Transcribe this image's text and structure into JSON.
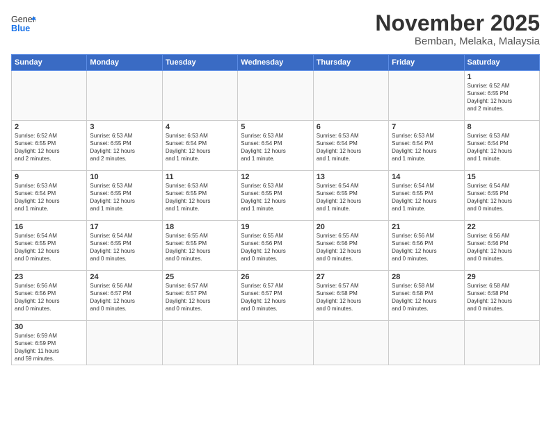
{
  "header": {
    "logo_general": "General",
    "logo_blue": "Blue",
    "title": "November 2025",
    "subtitle": "Bemban, Melaka, Malaysia"
  },
  "days_of_week": [
    "Sunday",
    "Monday",
    "Tuesday",
    "Wednesday",
    "Thursday",
    "Friday",
    "Saturday"
  ],
  "weeks": [
    [
      {
        "day": "",
        "info": ""
      },
      {
        "day": "",
        "info": ""
      },
      {
        "day": "",
        "info": ""
      },
      {
        "day": "",
        "info": ""
      },
      {
        "day": "",
        "info": ""
      },
      {
        "day": "",
        "info": ""
      },
      {
        "day": "1",
        "info": "Sunrise: 6:52 AM\nSunset: 6:55 PM\nDaylight: 12 hours\nand 2 minutes."
      }
    ],
    [
      {
        "day": "2",
        "info": "Sunrise: 6:52 AM\nSunset: 6:55 PM\nDaylight: 12 hours\nand 2 minutes."
      },
      {
        "day": "3",
        "info": "Sunrise: 6:53 AM\nSunset: 6:55 PM\nDaylight: 12 hours\nand 2 minutes."
      },
      {
        "day": "4",
        "info": "Sunrise: 6:53 AM\nSunset: 6:54 PM\nDaylight: 12 hours\nand 1 minute."
      },
      {
        "day": "5",
        "info": "Sunrise: 6:53 AM\nSunset: 6:54 PM\nDaylight: 12 hours\nand 1 minute."
      },
      {
        "day": "6",
        "info": "Sunrise: 6:53 AM\nSunset: 6:54 PM\nDaylight: 12 hours\nand 1 minute."
      },
      {
        "day": "7",
        "info": "Sunrise: 6:53 AM\nSunset: 6:54 PM\nDaylight: 12 hours\nand 1 minute."
      },
      {
        "day": "8",
        "info": "Sunrise: 6:53 AM\nSunset: 6:54 PM\nDaylight: 12 hours\nand 1 minute."
      }
    ],
    [
      {
        "day": "9",
        "info": "Sunrise: 6:53 AM\nSunset: 6:54 PM\nDaylight: 12 hours\nand 1 minute."
      },
      {
        "day": "10",
        "info": "Sunrise: 6:53 AM\nSunset: 6:55 PM\nDaylight: 12 hours\nand 1 minute."
      },
      {
        "day": "11",
        "info": "Sunrise: 6:53 AM\nSunset: 6:55 PM\nDaylight: 12 hours\nand 1 minute."
      },
      {
        "day": "12",
        "info": "Sunrise: 6:53 AM\nSunset: 6:55 PM\nDaylight: 12 hours\nand 1 minute."
      },
      {
        "day": "13",
        "info": "Sunrise: 6:54 AM\nSunset: 6:55 PM\nDaylight: 12 hours\nand 1 minute."
      },
      {
        "day": "14",
        "info": "Sunrise: 6:54 AM\nSunset: 6:55 PM\nDaylight: 12 hours\nand 1 minute."
      },
      {
        "day": "15",
        "info": "Sunrise: 6:54 AM\nSunset: 6:55 PM\nDaylight: 12 hours\nand 0 minutes."
      }
    ],
    [
      {
        "day": "16",
        "info": "Sunrise: 6:54 AM\nSunset: 6:55 PM\nDaylight: 12 hours\nand 0 minutes."
      },
      {
        "day": "17",
        "info": "Sunrise: 6:54 AM\nSunset: 6:55 PM\nDaylight: 12 hours\nand 0 minutes."
      },
      {
        "day": "18",
        "info": "Sunrise: 6:55 AM\nSunset: 6:55 PM\nDaylight: 12 hours\nand 0 minutes."
      },
      {
        "day": "19",
        "info": "Sunrise: 6:55 AM\nSunset: 6:56 PM\nDaylight: 12 hours\nand 0 minutes."
      },
      {
        "day": "20",
        "info": "Sunrise: 6:55 AM\nSunset: 6:56 PM\nDaylight: 12 hours\nand 0 minutes."
      },
      {
        "day": "21",
        "info": "Sunrise: 6:56 AM\nSunset: 6:56 PM\nDaylight: 12 hours\nand 0 minutes."
      },
      {
        "day": "22",
        "info": "Sunrise: 6:56 AM\nSunset: 6:56 PM\nDaylight: 12 hours\nand 0 minutes."
      }
    ],
    [
      {
        "day": "23",
        "info": "Sunrise: 6:56 AM\nSunset: 6:56 PM\nDaylight: 12 hours\nand 0 minutes."
      },
      {
        "day": "24",
        "info": "Sunrise: 6:56 AM\nSunset: 6:57 PM\nDaylight: 12 hours\nand 0 minutes."
      },
      {
        "day": "25",
        "info": "Sunrise: 6:57 AM\nSunset: 6:57 PM\nDaylight: 12 hours\nand 0 minutes."
      },
      {
        "day": "26",
        "info": "Sunrise: 6:57 AM\nSunset: 6:57 PM\nDaylight: 12 hours\nand 0 minutes."
      },
      {
        "day": "27",
        "info": "Sunrise: 6:57 AM\nSunset: 6:58 PM\nDaylight: 12 hours\nand 0 minutes."
      },
      {
        "day": "28",
        "info": "Sunrise: 6:58 AM\nSunset: 6:58 PM\nDaylight: 12 hours\nand 0 minutes."
      },
      {
        "day": "29",
        "info": "Sunrise: 6:58 AM\nSunset: 6:58 PM\nDaylight: 12 hours\nand 0 minutes."
      }
    ],
    [
      {
        "day": "30",
        "info": "Sunrise: 6:59 AM\nSunset: 6:59 PM\nDaylight: 11 hours\nand 59 minutes."
      },
      {
        "day": "",
        "info": ""
      },
      {
        "day": "",
        "info": ""
      },
      {
        "day": "",
        "info": ""
      },
      {
        "day": "",
        "info": ""
      },
      {
        "day": "",
        "info": ""
      },
      {
        "day": "",
        "info": ""
      }
    ]
  ]
}
